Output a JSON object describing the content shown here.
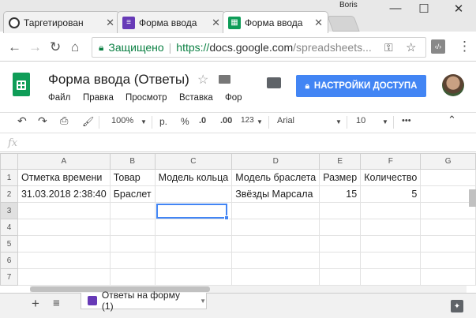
{
  "browser": {
    "profile_name": "Boris",
    "tabs": [
      {
        "label": "Таргетирован",
        "icon": "circle-icon",
        "color": "#333333"
      },
      {
        "label": "Форма ввода",
        "icon": "forms-icon",
        "color": "#673ab7"
      },
      {
        "label": "Форма ввода",
        "icon": "sheets-icon",
        "color": "#0f9d58"
      }
    ],
    "address": {
      "secure_label": "Защищено",
      "url_prefix": "https://",
      "url_host": "docs.google.com",
      "url_path": "/spreadsheets..."
    }
  },
  "doc": {
    "title": "Форма ввода (Ответы)",
    "menu": [
      "Файл",
      "Правка",
      "Просмотр",
      "Вставка",
      "Фор"
    ],
    "share_label": "НАСТРОЙКИ ДОСТУПА"
  },
  "toolbar": {
    "zoom": "100%",
    "currency": "р.",
    "percent": "%",
    "dec_less": ".0",
    "dec_more": ".00",
    "format": "123",
    "font": "Arial",
    "font_size": "10",
    "more": "•••"
  },
  "formula_bar": {
    "fx_label": "fx",
    "value": ""
  },
  "sheet": {
    "column_letters": [
      "A",
      "B",
      "C",
      "D",
      "E",
      "F",
      "G"
    ],
    "row_numbers": [
      "1",
      "2",
      "3",
      "4",
      "5",
      "6",
      "7"
    ],
    "headers": [
      "Отметка времени",
      "Товар",
      "Модель кольца",
      "Модель браслета",
      "Размер",
      "Количество",
      ""
    ],
    "rows": [
      [
        "31.03.2018 2:38:40",
        "Браслет",
        "",
        "Звёзды Марсала",
        "15",
        "5",
        ""
      ]
    ],
    "selected_cell": "C3"
  },
  "footer": {
    "add_sheet": "+",
    "all_sheets": "≡",
    "active_sheet": "Ответы на форму (1)"
  }
}
